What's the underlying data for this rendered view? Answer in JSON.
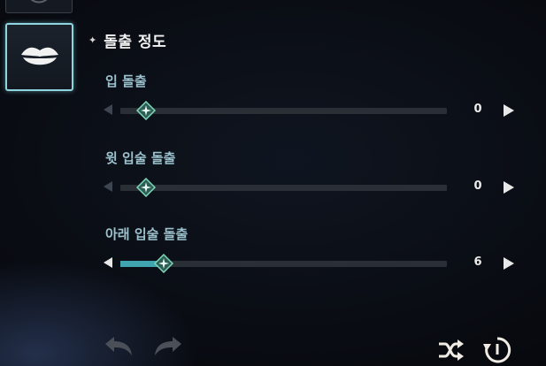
{
  "section": {
    "title": "돌출 정도"
  },
  "sliders": [
    {
      "label": "입 돌출",
      "value": "0",
      "level": 0
    },
    {
      "label": "윗 입술 돌출",
      "value": "0",
      "level": 0
    },
    {
      "label": "아래 입술 돌출",
      "value": "6",
      "level": 6
    }
  ],
  "colors": {
    "accent": "#8fd5e0",
    "fill": "#3fa4b0",
    "label": "#9cc2ce",
    "thumb": "#5bb89c"
  },
  "icons": {
    "tab_top": "creature-icon",
    "tab_active": "lips-icon",
    "undo": "undo-icon",
    "redo": "redo-icon",
    "randomize": "shuffle-icon",
    "reset": "reset-icon"
  }
}
